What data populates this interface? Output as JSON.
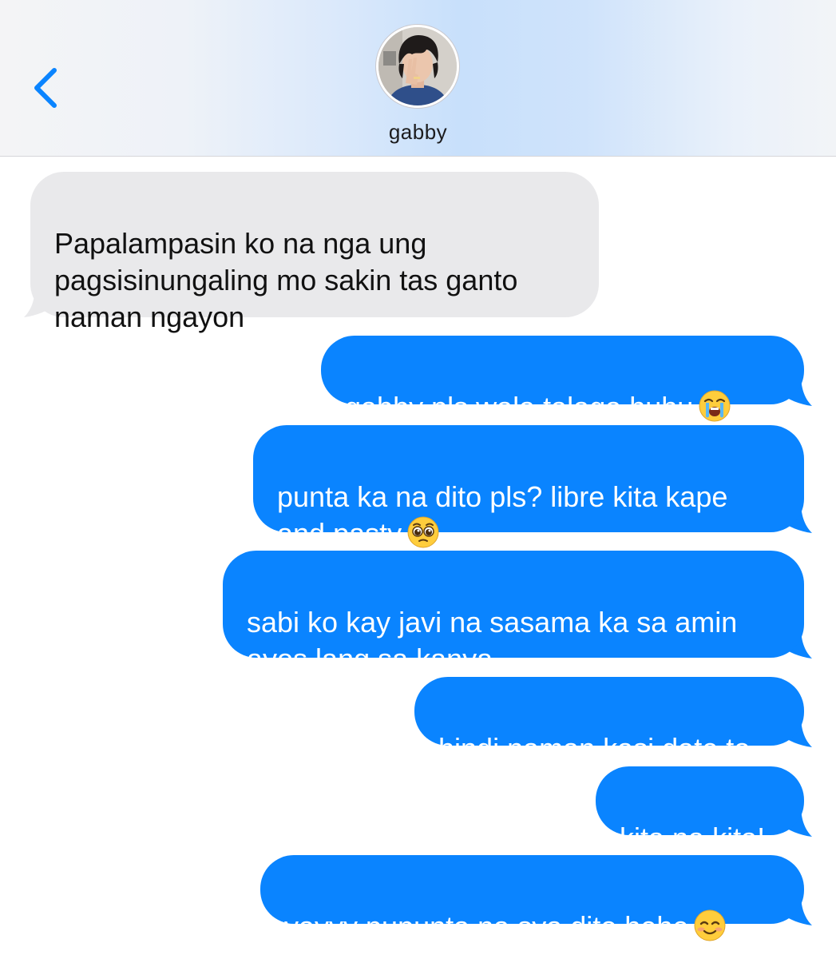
{
  "header": {
    "contact_name": "gabby",
    "back_icon": "chevron-left-icon",
    "accent_color": "#0a84ff"
  },
  "messages": [
    {
      "from": "them",
      "text": "Papalampasin ko na nga ung\npagsisinungaling mo sakin tas ganto\nnaman ngayon",
      "emoji": ""
    },
    {
      "from": "me",
      "text": "gabby pls wala talaga huhu",
      "emoji": "loudly-crying-face"
    },
    {
      "from": "me",
      "text": "punta ka na dito pls? libre kita kape\nand pasty",
      "emoji": "pleading-face"
    },
    {
      "from": "me",
      "text": "sabi ko kay javi na sasama ka sa amin\nayos lang sa kanya",
      "emoji": ""
    },
    {
      "from": "me",
      "text": "hindi naman kasi date to",
      "emoji": ""
    },
    {
      "from": "me",
      "text": "kita na kita!",
      "emoji": ""
    },
    {
      "from": "me",
      "text": "yayyy pupunta na sya dito hehe",
      "emoji": "smiling-face"
    }
  ],
  "colors": {
    "incoming_bubble": "#e9e9eb",
    "outgoing_bubble": "#0a84ff",
    "incoming_text": "#111111",
    "outgoing_text": "#ffffff"
  }
}
